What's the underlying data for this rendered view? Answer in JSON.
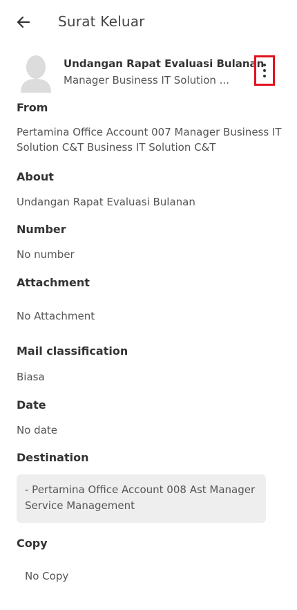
{
  "topbar": {
    "title": "Surat Keluar",
    "back_icon": "arrow-left-icon"
  },
  "header": {
    "subject": "Undangan Rapat Evaluasi Bulanan",
    "sender_short": "Manager Business IT Solution ...",
    "more_icon": "more-vertical-icon",
    "highlight_color": "#e0121c"
  },
  "details": {
    "from_label": "From",
    "from_value": "Pertamina Office Account 007 Manager Business IT Solution C&T Business IT Solution C&T",
    "about_label": "About",
    "about_value": "Undangan Rapat Evaluasi Bulanan",
    "number_label": "Number",
    "number_value": "No number",
    "attachment_label": "Attachment",
    "attachment_value": "No Attachment",
    "classification_label": "Mail classification",
    "classification_value": "Biasa",
    "date_label": "Date",
    "date_value": "No date",
    "destination_label": "Destination",
    "destination_value": "- Pertamina Office Account 008 Ast Manager Service Management",
    "copy_label": "Copy",
    "copy_value": "No Copy"
  }
}
